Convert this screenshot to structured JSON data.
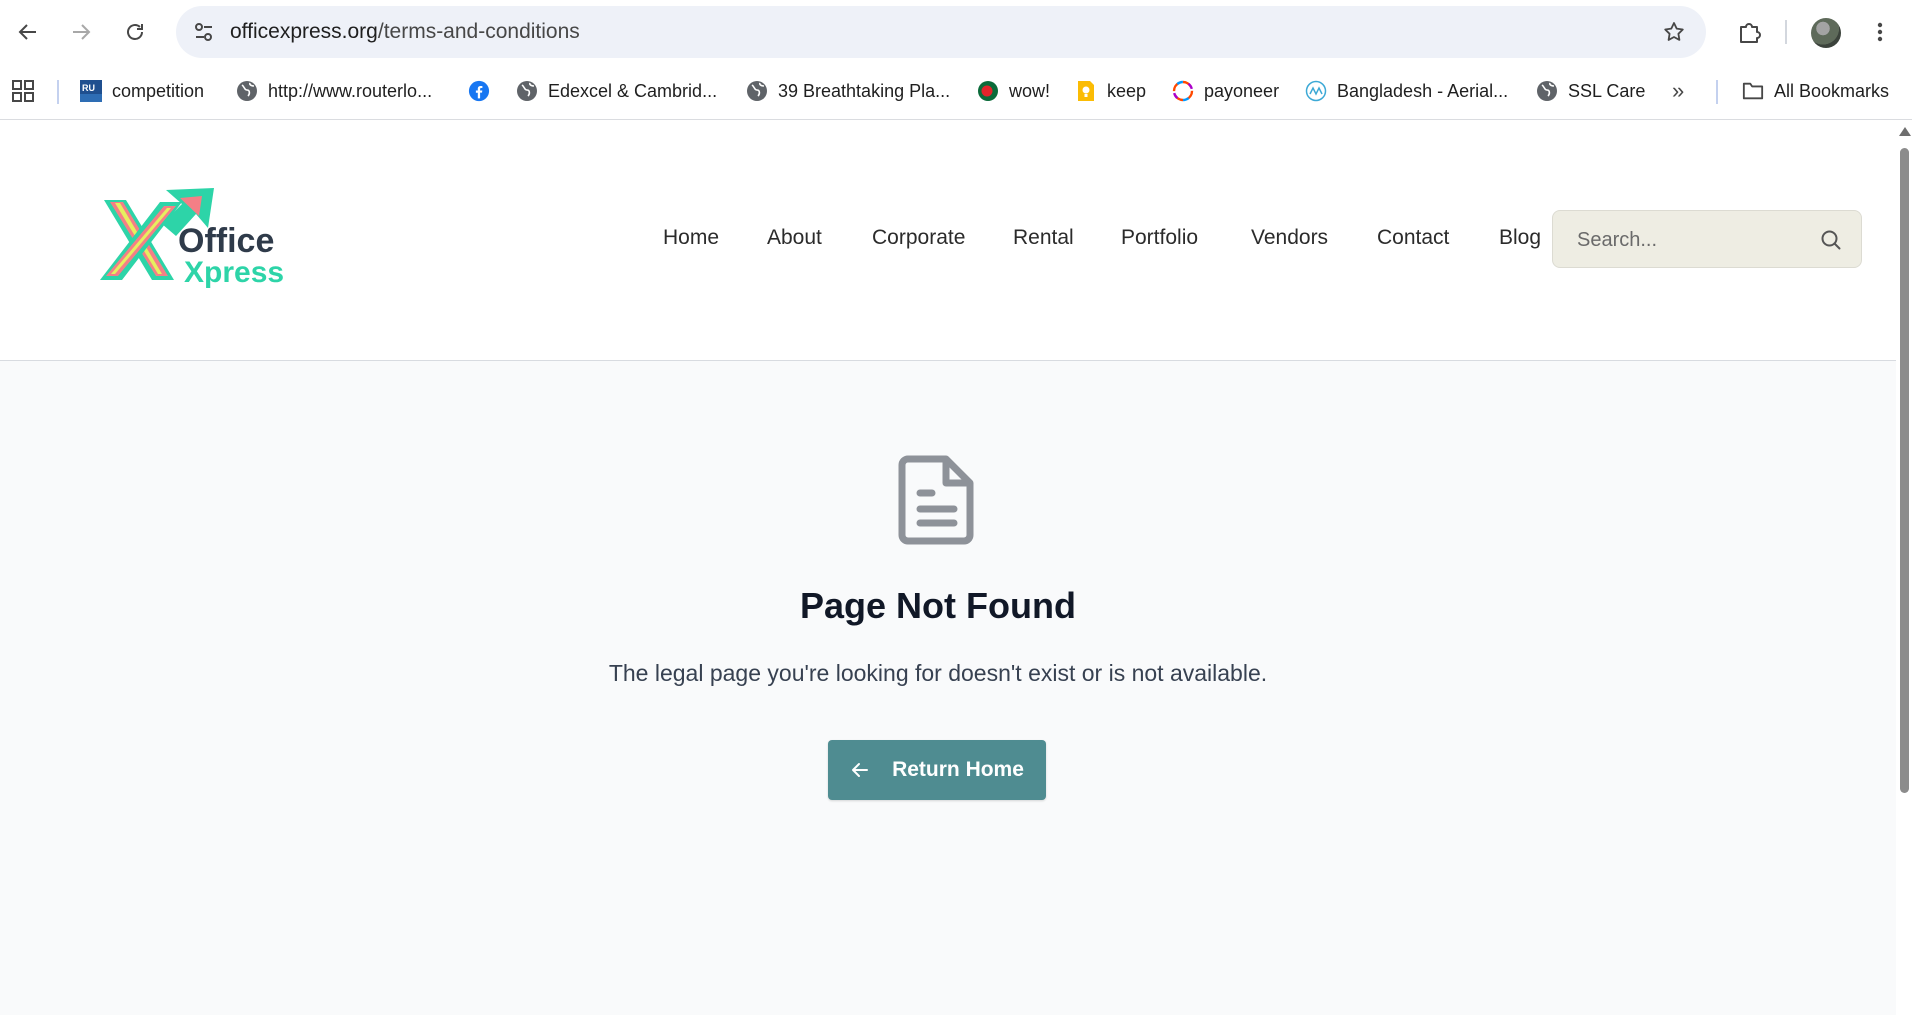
{
  "browser": {
    "url_host": "officexpress.org",
    "url_path": "/terms-and-conditions",
    "bookmarks": [
      {
        "label": "competition",
        "icon": "ru-favicon"
      },
      {
        "label": "http://www.routerlo...",
        "icon": "globe-icon"
      },
      {
        "label": "",
        "icon": "facebook-icon"
      },
      {
        "label": "Edexcel & Cambrid...",
        "icon": "globe-icon"
      },
      {
        "label": "39 Breathtaking Pla...",
        "icon": "globe-icon"
      },
      {
        "label": "wow!",
        "icon": "bangladesh-flag-icon"
      },
      {
        "label": "keep",
        "icon": "keep-icon"
      },
      {
        "label": "payoneer",
        "icon": "payoneer-icon"
      },
      {
        "label": "Bangladesh - Aerial...",
        "icon": "aerial-icon"
      },
      {
        "label": "SSL Care",
        "icon": "globe-icon"
      }
    ],
    "more_bookmarks": "»",
    "all_bookmarks": "All Bookmarks"
  },
  "site": {
    "logo_line1": "Office",
    "logo_line2": "Xpress",
    "nav": [
      "Home",
      "About",
      "Corporate",
      "Rental",
      "Portfolio",
      "Vendors",
      "Contact",
      "Blog"
    ],
    "search_placeholder": "Search..."
  },
  "error": {
    "title": "Page Not Found",
    "message": "The legal page you're looking for doesn't exist or is not available.",
    "button_label": "Return Home"
  },
  "colors": {
    "accent": "#4f8c91",
    "page_bg": "#f9fafb",
    "search_bg": "#eeede3",
    "logo_green": "#2dd4a8",
    "logo_pink": "#f47f86",
    "logo_yellow": "#e6ef5f"
  }
}
